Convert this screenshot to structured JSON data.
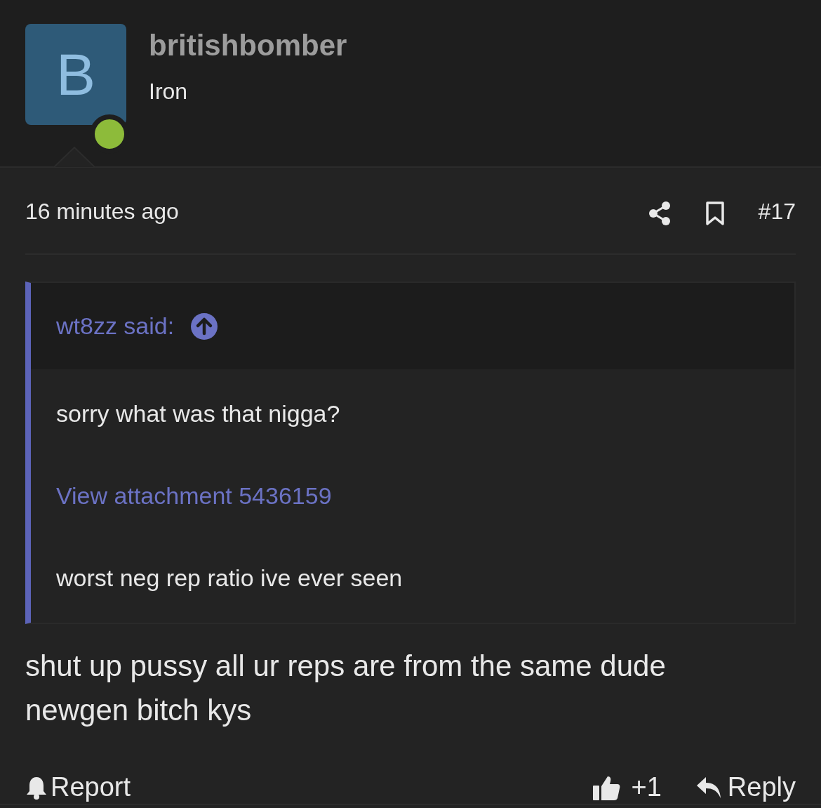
{
  "post": {
    "author": {
      "initial": "B",
      "name": "britishbomber",
      "title": "Iron",
      "online": true
    },
    "time": "16 minutes ago",
    "number": "#17",
    "quote": {
      "author": "wt8zz said:",
      "lines": [
        {
          "kind": "text",
          "text": "sorry what was that nigga?"
        },
        {
          "kind": "link",
          "text": "View attachment 5436159"
        },
        {
          "kind": "text",
          "text": "worst neg rep ratio ive ever seen"
        }
      ]
    },
    "body": "shut up pussy all ur reps are from the same dude newgen bitch kys",
    "actions": {
      "report": "Report",
      "reactions": "+1",
      "reply": "Reply"
    }
  }
}
